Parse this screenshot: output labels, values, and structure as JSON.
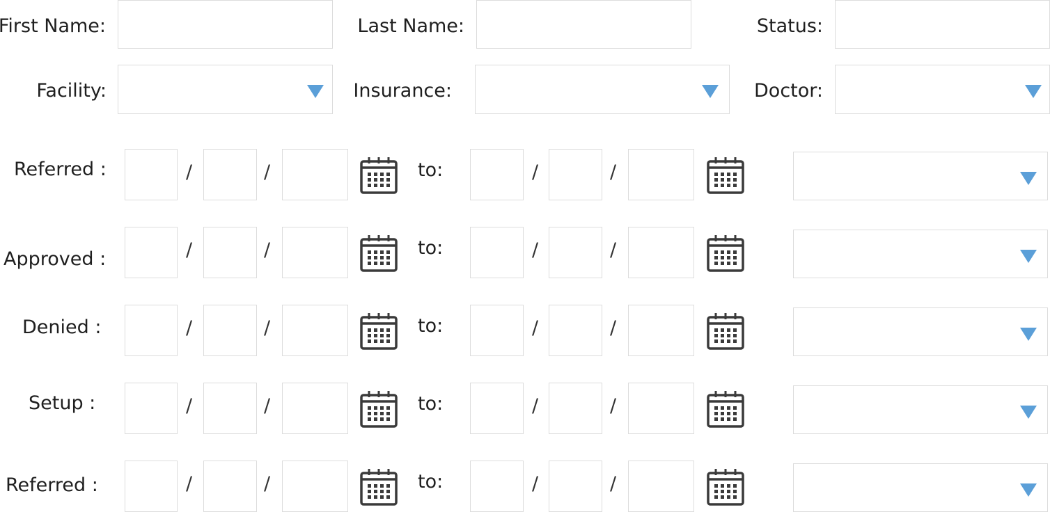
{
  "filters": {
    "first_name_label": "First Name:",
    "last_name_label": "Last Name:",
    "status_label": "Status:",
    "facility_label": "Facility:",
    "insurance_label": "Insurance:",
    "doctor_label": "Doctor:"
  },
  "date_rows": [
    {
      "label": "Referred :",
      "separator": "/",
      "to_label": "to:"
    },
    {
      "label": "Approved :",
      "separator": "/",
      "to_label": "to:"
    },
    {
      "label": "Denied :",
      "separator": "/",
      "to_label": "to:"
    },
    {
      "label": "Setup :",
      "separator": "/",
      "to_label": "to:"
    },
    {
      "label": "Referred :",
      "separator": "/",
      "to_label": "to:"
    }
  ],
  "icons": {
    "calendar": "calendar-icon",
    "dropdown": "triangle-down-icon"
  },
  "colors": {
    "dropdown_arrow": "#5b9fd8",
    "border": "#dcdcdc",
    "icon": "#3a3a3a"
  }
}
